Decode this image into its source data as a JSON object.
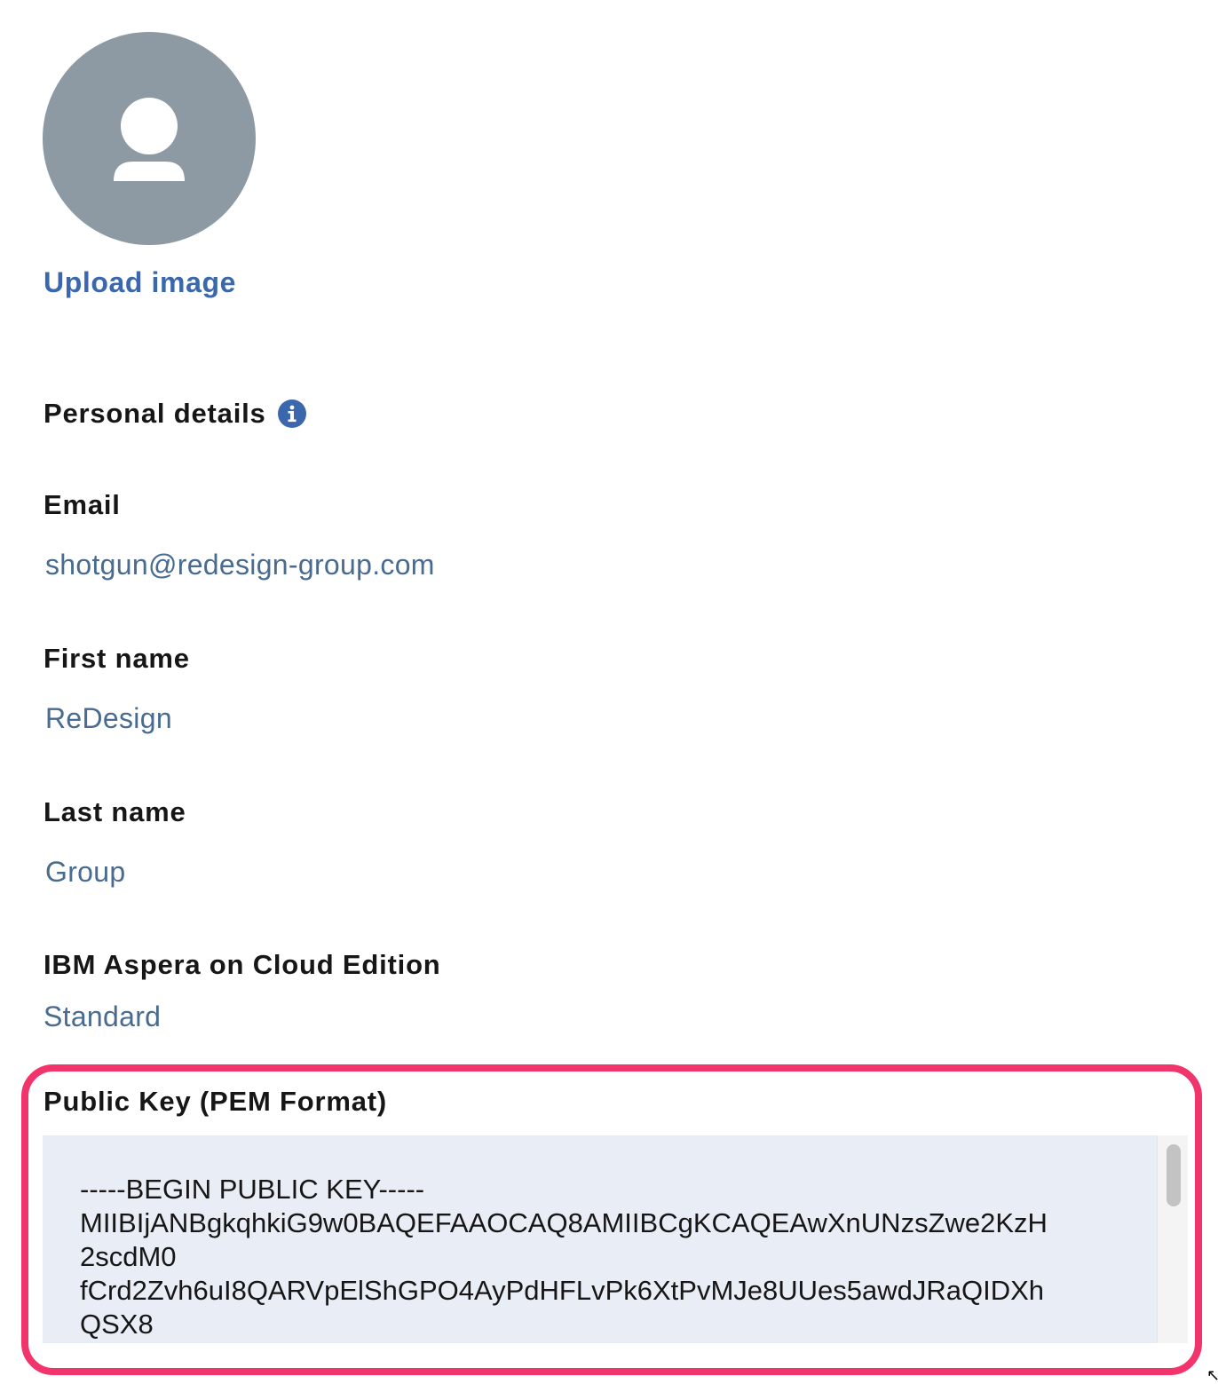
{
  "profile": {
    "upload_label": "Upload image"
  },
  "personal_details": {
    "title": "Personal details"
  },
  "fields": {
    "email": {
      "label": "Email",
      "value": "shotgun@redesign-group.com"
    },
    "first_name": {
      "label": "First name",
      "value": "ReDesign"
    },
    "last_name": {
      "label": "Last name",
      "value": "Group"
    },
    "edition": {
      "label": "IBM Aspera on Cloud Edition",
      "value": "Standard"
    }
  },
  "public_key": {
    "label": "Public Key (PEM Format)",
    "value": "-----BEGIN PUBLIC KEY-----\nMIIBIjANBgkqhkiG9w0BAQEFAAOCAQ8AMIIBCgKCAQEAwXnUNzsZwe2KzH\n2scdM0\nfCrd2Zvh6uI8QARVpElShGPO4AyPdHFLvPk6XtPvMJe8UUes5awdJRaQIDXh\nQSX8"
  },
  "colors": {
    "accent": "#3b68ad",
    "value_text": "#486b8f",
    "avatar": "#8d99a3",
    "highlight": "#f2346c",
    "pem_background": "#e9eef6"
  }
}
